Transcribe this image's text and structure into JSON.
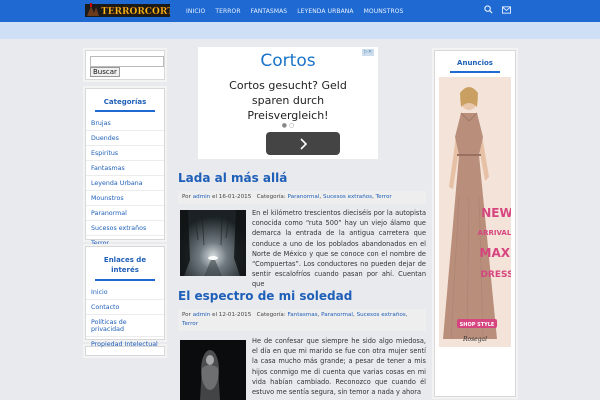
{
  "header": {
    "logo_text": "TERRORCORTOS",
    "nav": [
      "INICIO",
      "TERROR",
      "FANTASMAS",
      "LEYENDA URBANA",
      "MOUNSTROS"
    ],
    "colors": {
      "bar": "#1e6ad2",
      "subbar": "#cfe0f6",
      "link": "#1e5fb8"
    }
  },
  "search": {
    "button_label": "Buscar",
    "value": ""
  },
  "categories": {
    "title": "Categorías",
    "items": [
      "Brujas",
      "Duendes",
      "Espiritus",
      "Fantasmas",
      "Leyenda Urbana",
      "Mounstros",
      "Paranormal",
      "Sucesos extraños",
      "Terror"
    ]
  },
  "links": {
    "title_line1": "Enlaces de",
    "title_line2": "interés",
    "items": [
      "Inicio",
      "Contacto",
      "Políticas de privacidad",
      "Propiedad Intelectual"
    ]
  },
  "ad": {
    "title": "Cortos",
    "body_line1": "Cortos gesucht? Geld",
    "body_line2": "sparen durch",
    "body_line3": "Preisvergleich!",
    "button_icon": "chevron-right-icon"
  },
  "posts": [
    {
      "title": "Lada al más allá",
      "meta_by": "Por",
      "author": "admin",
      "meta_on": "el",
      "date": "16-01-2015",
      "cat_label": "Categoría:",
      "categories": [
        "Paranormal",
        "Sucesos extraños",
        "Terror"
      ],
      "excerpt": "En el kilómetro trescientos dieciséis por la autopista conocida como “ruta 500” hay un viejo álamo que demarca la entrada de la antigua carretera que conduce a uno de los poblados abandonados en el Norte de México y que se conoce con el nombre de “Compuertas”. Los conductores no pueden dejar de sentir escalofríos cuando pasan por ahí. Cuentan que"
    },
    {
      "title": "El espectro de mi soledad",
      "meta_by": "Por",
      "author": "admin",
      "meta_on": "el",
      "date": "12-01-2015",
      "cat_label": "Categoría:",
      "categories": [
        "Fantasmas",
        "Paranormal",
        "Sucesos extraños",
        "Terror"
      ],
      "excerpt": "He de confesar que siempre he sido algo miedosa, el día en que mi marido se fue con otra mujer sentí la casa mucho más grande; a pesar de tener a mis hijos conmigo me di cuenta que varias cosas en mi vida habían cambiado. Reconozco que cuando él estuvo me sentía segura, sin temor a nada y ahora"
    }
  ],
  "right": {
    "title": "Anuncios",
    "banner_text_line1": "NEW",
    "banner_text_line2": "ARRIVALS",
    "banner_text_line3": "MAXI",
    "banner_text_line4": "DRESS",
    "banner_cta": "SHOP STYLE",
    "banner_brand": "Rosegal"
  }
}
